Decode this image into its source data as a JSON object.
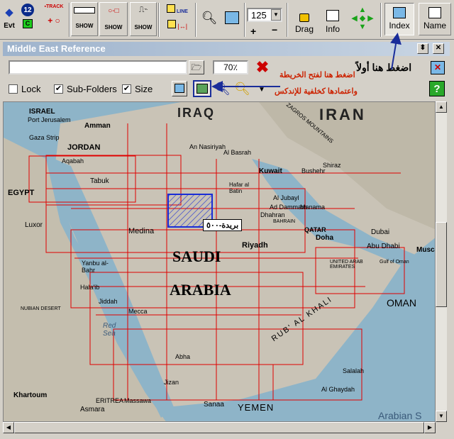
{
  "toolbar": {
    "evt_label": "Evt",
    "waypoint_count": "12",
    "track_label": "TRACK",
    "show_label_1": "SHOW",
    "show_label_2": "SHOW",
    "show_label_3": "SHOW",
    "line_label": "LINE",
    "zoom_value": "125",
    "drag_label": "Drag",
    "info_label": "Info",
    "index_label": "Index",
    "name_label": "Name"
  },
  "window": {
    "title": "Middle East Reference",
    "percent": "70٪",
    "lock_label": "Lock",
    "subfolders_label": "Sub-Folders",
    "size_label": "Size",
    "lock_checked": false,
    "subfolders_checked": true,
    "size_checked": true
  },
  "annotations": {
    "press_first": "اضغط هنا أولاً",
    "open_map_line1": "اضغط هنا لفتح الخريطة",
    "open_map_line2": "واعتمادها كخلفية للإندكس",
    "map_label": "بريدة-٥٠٠"
  },
  "map_labels": {
    "israel": "ISRAEL",
    "port_jerusalem": "Port Jerusalem",
    "jordan": "JORDAN",
    "amman": "Amman",
    "gaza": "Gaza Strip",
    "aqaba": "Aqabah",
    "egypt": "EGYPT",
    "tabuk": "Tabuk",
    "iraq": "IRAQ",
    "iran": "IRAN",
    "an_nasiriyah": "An Nasiriyah",
    "al_basrah": "Al Basrah",
    "kuwait": "Kuwait",
    "bushehr": "Bushehr",
    "shiraz": "Shiraz",
    "hafar": "Hafar al Batin",
    "al_jubayl": "Al Jubayl",
    "dammam": "Ad Dammam",
    "dhahran": "Dhahran",
    "manama": "Manama",
    "bahrain": "BAHRAIN",
    "qatar": "QATAR",
    "doha": "Doha",
    "dubai": "Dubai",
    "abu_dhabi": "Abu Dhabi",
    "uae": "UNITED ARAB EMIRATES",
    "muscat": "Muscat",
    "oman": "OMAN",
    "saudi": "SAUDI",
    "arabia": "ARABIA",
    "riyadh": "Riyadh",
    "medina": "Medina",
    "luxor": "Luxor",
    "yanbu": "Yanbu al-Bahr",
    "halaib": "Hala'ib",
    "jiddah": "Jiddah",
    "mecca": "Mecca",
    "red_sea": "Red Sea",
    "nubian": "NUBIAN DESERT",
    "abha": "Abha",
    "jizan": "Jizan",
    "rub_al_khali": "RUB' AL KHALI",
    "salalah": "Salalah",
    "al_ghaydah": "Al Ghaydah",
    "sanaa": "Sanaa",
    "yemen": "YEMEN",
    "khartoum": "Khartoum",
    "eritrea": "ERITREA",
    "massawa": "Massawa",
    "asmara": "Asmara",
    "arabian_sea": "Arabian S",
    "zagros": "ZAGROS MOUNTAINS",
    "gulf_of_oman": "Gulf of Oman"
  },
  "colors": {
    "grid": "#e00000",
    "selected": "#1a2dd6",
    "arrow": "#1a2d9a",
    "annotation_red": "#cc2200"
  }
}
